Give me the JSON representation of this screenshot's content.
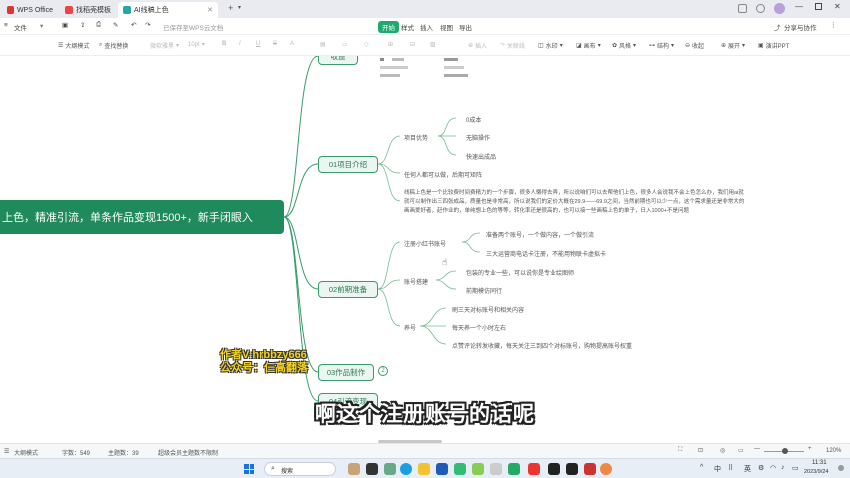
{
  "tabs": [
    {
      "label": "WPS Office",
      "color": "#d33"
    },
    {
      "label": "找稻壳模板",
      "color": "#e44"
    },
    {
      "label": "AI线稿上色",
      "color": "#2aa"
    }
  ],
  "menubar": {
    "file": "文件",
    "save_status": "已保存至WPS云文档",
    "start": "开始",
    "style": "样式",
    "insert": "插入",
    "view": "视图",
    "export": "导出",
    "share": "分享与协作"
  },
  "toolbar": {
    "outline_mode": "大纲模式",
    "find_replace": "查找替换",
    "font_name": "微软雅黑",
    "font_size": "10pt",
    "bold": "B",
    "italic": "I",
    "underline": "U",
    "strike": "S",
    "text_color": "A",
    "insert_child": "插入",
    "association": "关联线",
    "watermark": "水印",
    "canvas": "画布",
    "style": "风格",
    "structure": "结构",
    "collapse": "收起",
    "expand": "展开",
    "present": "演讲PPT"
  },
  "mindmap": {
    "root": "上色，精准引流，单条作品变现1500+，新手闭眼入",
    "branch0": "收益",
    "branch1": {
      "label": "01项目介绍",
      "advantages": "项目优势",
      "adv_items": [
        "0成本",
        "无脑操作",
        "快速出成品"
      ],
      "anyone": "任何人都可以做，后期可矩阵",
      "desc_line1": "线稿上色是一个比较费时间费精力的一个步骤，很多人懒得去弄，所以说咱们可以去帮他们上色，很多人会说我不会上色怎么办，我们用ai就",
      "desc_line2": "就可以制作出三四张成品，质量也是非常高，所以说我们的定价大概在29.9——69.9之间，当然前期也可以少一点，这个需求量还是非常大的",
      "desc_line3": "画画爱好者，赶作业的，单纯想上色的等等，转化率还是很高的，也可以接一些画稿上色的单子，日入1000+不是问题"
    },
    "branch2": {
      "label": "02前期准备",
      "register": "注册小红书账号",
      "register_items": [
        "准备两个账号，一个做内容，一个做引流",
        "三大运营商电话卡注册，不能用物联卡虚拟卡"
      ],
      "account_setup": "账号搭建",
      "setup_items": [
        "包装的专业一些，可以说你是专业绘图师",
        "前期模仿同行"
      ],
      "nurture": "养号",
      "nurture_items": [
        "刷三天对标账号和相关内容",
        "每天养一个小时左右",
        "点赞评论转发收藏，每天关注三到四个对标账号，购物提高账号权重"
      ]
    },
    "branch3": {
      "label": "03作品制作",
      "count": "2"
    },
    "branch4": "04引流变现"
  },
  "watermark": {
    "line1": "作者V:hrbbzy666",
    "line2": "公众号：仨高翻落"
  },
  "subtitle": "啊这个注册账号的话呢",
  "status": {
    "outline": "大纲模式",
    "word_count": "字数：549",
    "topic_count": "主题数：39",
    "member": "超级会员主题数不限制",
    "zoom": "120%"
  },
  "taskbar": {
    "search": "搜索",
    "lang": "中",
    "ime": "英",
    "time": "11:31",
    "date": "2023/9/24"
  },
  "colors": {
    "accent": "#1f8a5b",
    "branch_border": "#3a9a6a"
  }
}
